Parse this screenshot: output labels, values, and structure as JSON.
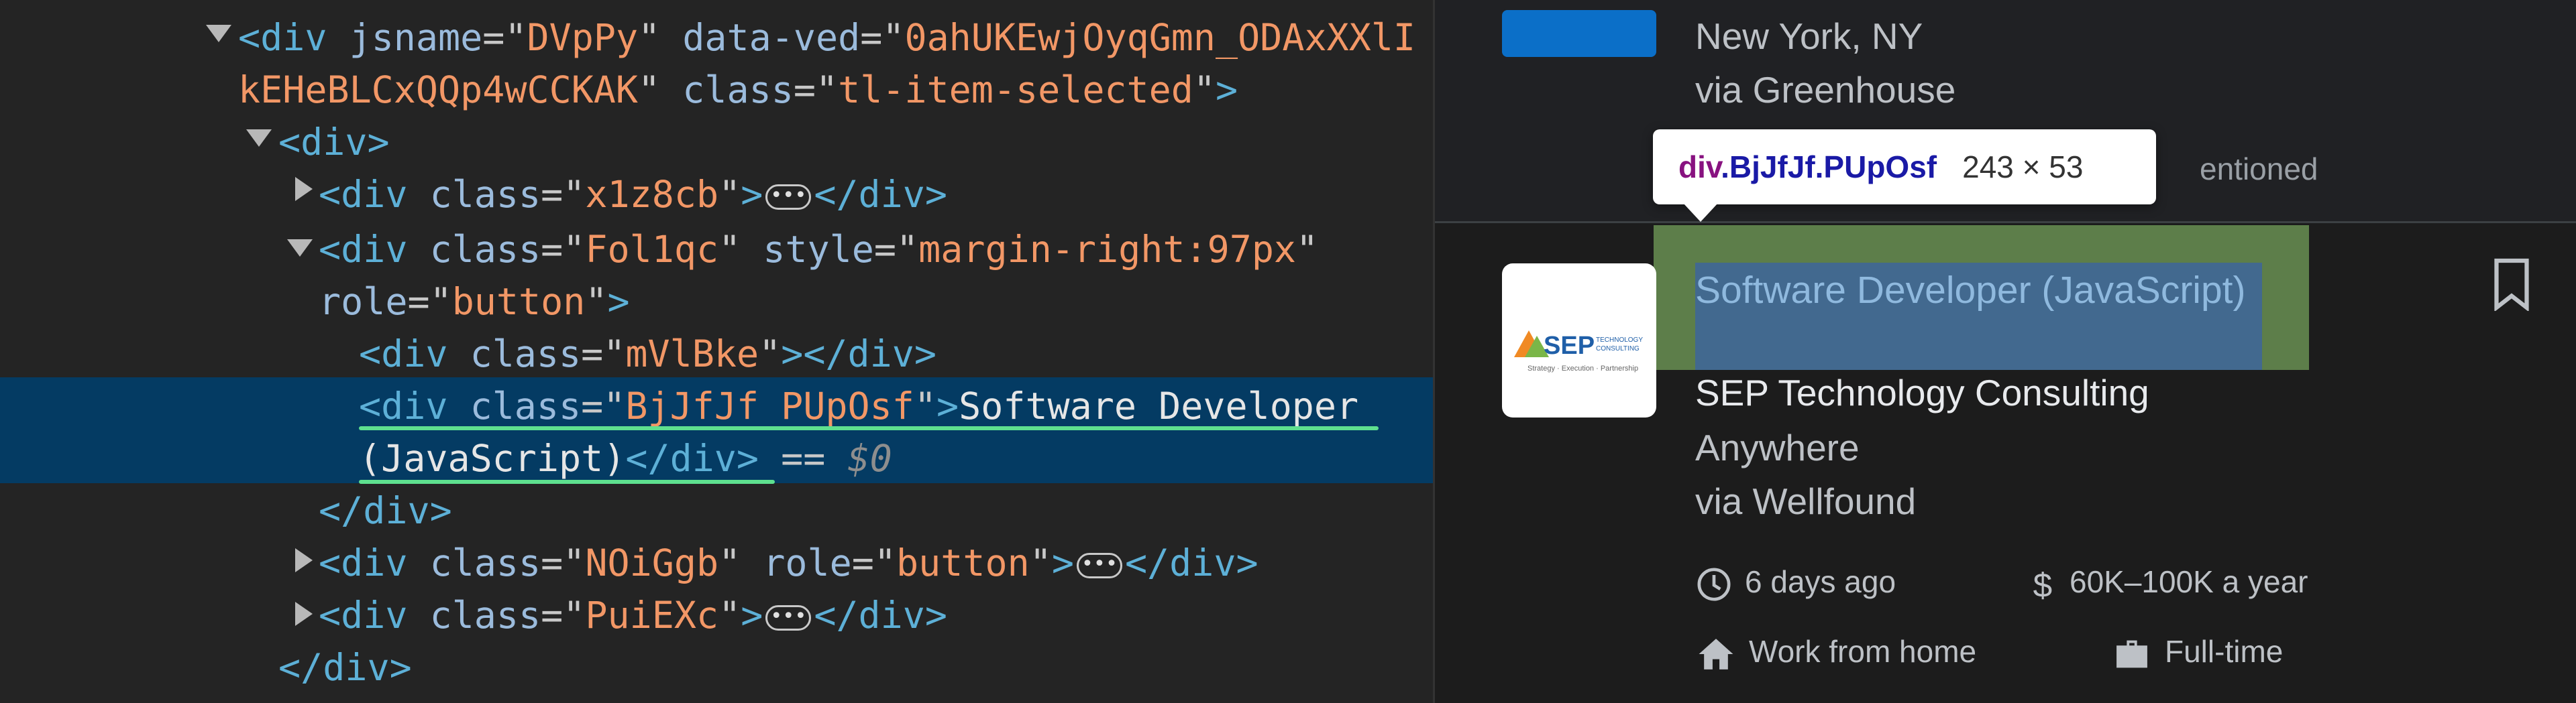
{
  "devtools": {
    "lines": [
      {
        "parts": [
          [
            "tag",
            "<div "
          ],
          [
            "attr",
            "jsname"
          ],
          [
            "eq",
            "=\""
          ],
          [
            "val",
            "DVpPy"
          ],
          [
            "eq",
            "\" "
          ],
          [
            "attr",
            "data-ved"
          ],
          [
            "eq",
            "=\""
          ],
          [
            "val",
            "0ahUKEwjOyqGmn_ODAxXXlI"
          ]
        ]
      },
      {
        "parts": [
          [
            "val",
            "kEHeBLCxQQp4wCCKAK"
          ],
          [
            "eq",
            "\" "
          ],
          [
            "attr",
            "class"
          ],
          [
            "eq",
            "=\""
          ],
          [
            "val",
            "tl-item-selected"
          ],
          [
            "eq",
            "\""
          ],
          [
            "tag",
            ">"
          ]
        ]
      },
      {
        "parts": [
          [
            "tag",
            "<div>"
          ]
        ]
      },
      {
        "parts": [
          [
            "tag",
            "<div "
          ],
          [
            "attr",
            "class"
          ],
          [
            "eq",
            "=\""
          ],
          [
            "val",
            "x1z8cb"
          ],
          [
            "eq",
            "\""
          ],
          [
            "tag",
            ">"
          ],
          [
            "ellipsis",
            "•••"
          ],
          [
            "tag",
            "</div>"
          ]
        ]
      },
      {
        "parts": [
          [
            "tag",
            "<div "
          ],
          [
            "attr",
            "class"
          ],
          [
            "eq",
            "=\""
          ],
          [
            "val",
            "Fol1qc"
          ],
          [
            "eq",
            "\" "
          ],
          [
            "attr",
            "style"
          ],
          [
            "eq",
            "=\""
          ],
          [
            "val",
            "margin-right:97px"
          ],
          [
            "eq",
            "\""
          ]
        ]
      },
      {
        "parts": [
          [
            "attr",
            "role"
          ],
          [
            "eq",
            "=\""
          ],
          [
            "val",
            "button"
          ],
          [
            "eq",
            "\""
          ],
          [
            "tag",
            ">"
          ]
        ]
      },
      {
        "parts": [
          [
            "tag",
            "<div "
          ],
          [
            "attr",
            "class"
          ],
          [
            "eq",
            "=\""
          ],
          [
            "val",
            "mVlBke"
          ],
          [
            "eq",
            "\""
          ],
          [
            "tag",
            "></div>"
          ]
        ]
      },
      {
        "parts": [
          [
            "tag",
            "<div "
          ],
          [
            "attr",
            "class"
          ],
          [
            "eq",
            "=\""
          ],
          [
            "val",
            "BjJfJf PUpOsf"
          ],
          [
            "eq",
            "\""
          ],
          [
            "tag",
            ">"
          ],
          [
            "txt",
            "Software Developer"
          ]
        ]
      },
      {
        "parts": [
          [
            "txt",
            "(JavaScript)"
          ],
          [
            "tag",
            "</div>"
          ],
          [
            "eq",
            " == "
          ],
          [
            "dollar",
            "$0"
          ]
        ]
      },
      {
        "parts": [
          [
            "tag",
            "</div>"
          ]
        ]
      },
      {
        "parts": [
          [
            "tag",
            "<div "
          ],
          [
            "attr",
            "class"
          ],
          [
            "eq",
            "=\""
          ],
          [
            "val",
            "NOiGgb"
          ],
          [
            "eq",
            "\" "
          ],
          [
            "attr",
            "role"
          ],
          [
            "eq",
            "=\""
          ],
          [
            "val",
            "button"
          ],
          [
            "eq",
            "\""
          ],
          [
            "tag",
            ">"
          ],
          [
            "ellipsis",
            "•••"
          ],
          [
            "tag",
            "</div>"
          ]
        ]
      },
      {
        "parts": [
          [
            "tag",
            "<div "
          ],
          [
            "attr",
            "class"
          ],
          [
            "eq",
            "=\""
          ],
          [
            "val",
            "PuiEXc"
          ],
          [
            "eq",
            "\""
          ],
          [
            "tag",
            ">"
          ],
          [
            "ellipsis",
            "•••"
          ],
          [
            "tag",
            "</div>"
          ]
        ]
      },
      {
        "parts": [
          [
            "tag",
            "</div>"
          ]
        ]
      }
    ]
  },
  "prev_job": {
    "location": "New York, NY",
    "via": "via Greenhouse",
    "mentioned": "entioned"
  },
  "tooltip": {
    "element": "div",
    "classes": ".BjJfJf.PUpOsf",
    "size": "243 × 53"
  },
  "job": {
    "title": "Software Developer (JavaScript)",
    "company": "SEP Technology Consulting",
    "location": "Anywhere",
    "via": "via Wellfound",
    "posted": "6 days ago",
    "salary": "60K–100K a year",
    "work_type": "Work from home",
    "schedule": "Full-time",
    "logo_text": "SEP",
    "logo_small": "TECHNOLOGY CONSULTING",
    "logo_tagline": "Strategy · Execution · Partnership"
  },
  "colors": {
    "selected_row": "#043b63",
    "underline": "#5ee08f",
    "highlight_margin": "#5d7e4a",
    "highlight_content": "#42698f"
  }
}
